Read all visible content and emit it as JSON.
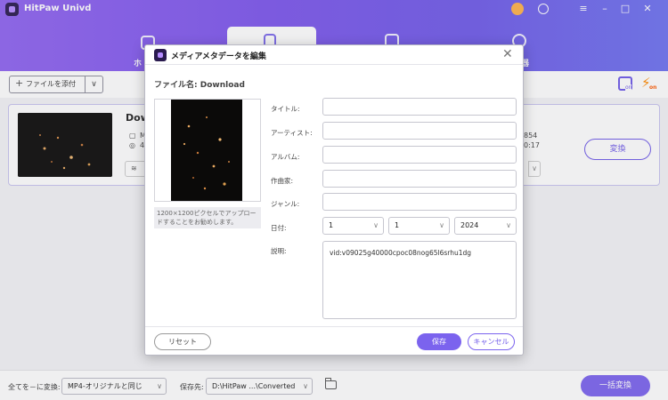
{
  "app": {
    "title": "HitPaw Univd",
    "nav_tabs": [
      {
        "label": "ホ"
      },
      {
        "label": ""
      },
      {
        "label": ""
      },
      {
        "label": "器"
      }
    ]
  },
  "toolbar": {
    "add_file_label": "ファイルを添付",
    "add_caret": "∨",
    "accel_badge": "on"
  },
  "file_card": {
    "name": "Dow",
    "meta_left_1": "M",
    "meta_left_2": "4",
    "meta_right_1": "854",
    "meta_right_2": "0:17",
    "convert_label": "変換"
  },
  "dialog": {
    "title": "メディアメタデータを編集",
    "file_label": "ファイル名: Download",
    "artwork_note": "1200×1200ピクセルでアップロードすることをお勧めします。",
    "fields": {
      "title_label": "タイトル:",
      "artist_label": "アーティスト:",
      "album_label": "アルバム:",
      "composer_label": "作曲家:",
      "genre_label": "ジャンル:",
      "date_label": "日付:",
      "description_label": "説明:"
    },
    "date": {
      "month": "1",
      "day": "1",
      "year": "2024"
    },
    "description": "vid:v09025g40000cpoc08nog65l6srhu1dg",
    "reset_label": "リセット",
    "save_label": "保存",
    "cancel_label": "キャンセル"
  },
  "bottom": {
    "convert_all_label": "全てを－に変換:",
    "format_value": "MP4-オリジナルと同じ",
    "save_to_label": "保存先:",
    "save_path": "D:\\HitPaw ...\\Converted",
    "batch_convert_label": "一括変換"
  },
  "colors": {
    "accent": "#7b63ee",
    "header_start": "#8f63f1",
    "header_end": "#6e72ef",
    "accel": "#ff8a00"
  }
}
